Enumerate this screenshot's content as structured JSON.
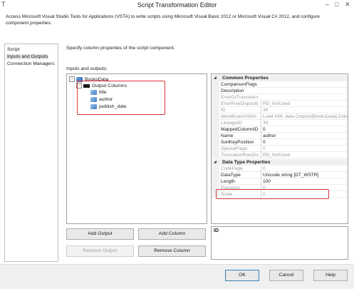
{
  "window": {
    "title": "Script Transformation Editor",
    "app_icon": "T",
    "minimize_glyph": "–",
    "maximize_glyph": "□",
    "close_glyph": "✕"
  },
  "description": "Access Microsoft Visual Studio Tools for Applications (VSTA) to write scripts using Microsoft Visual Basic 2012 or Microsoft Visual C# 2012, and configure component properties.",
  "nav": {
    "items": [
      {
        "label": "Script",
        "selected": false
      },
      {
        "label": "Inputs and Outputs",
        "selected": true
      },
      {
        "label": "Connection Managers",
        "selected": false
      }
    ]
  },
  "main": {
    "prompt": "Specify column properties of the script component.",
    "io_label": "Inputs and outputs:"
  },
  "tree": {
    "root": {
      "label": "BooksData",
      "expander": "−",
      "icon": "component-icon"
    },
    "folder": {
      "label": "Output Columns",
      "expander": "−",
      "icon": "folder-icon"
    },
    "columns": [
      {
        "label": "title",
        "icon": "column-icon"
      },
      {
        "label": "author",
        "icon": "column-icon"
      },
      {
        "label": "publish_date",
        "icon": "column-icon"
      }
    ]
  },
  "properties": {
    "common_header": "Common Properties",
    "common_rows": [
      {
        "name": "ComparisonFlags",
        "value": "",
        "readonly": false
      },
      {
        "name": "Description",
        "value": "",
        "readonly": false
      },
      {
        "name": "ErrorOrTruncation",
        "value": "",
        "readonly": true
      },
      {
        "name": "ErrorRowDispositi",
        "value": "RD_NotUsed",
        "readonly": true
      },
      {
        "name": "ID",
        "value": "39",
        "readonly": true
      },
      {
        "name": "IdentificationStrin",
        "value": "Load XML data.Outputs[BooksData].Colu",
        "readonly": true
      },
      {
        "name": "LineageID",
        "value": "39",
        "readonly": true
      },
      {
        "name": "MappedColumnID",
        "value": "0",
        "readonly": false
      },
      {
        "name": "Name",
        "value": "author",
        "readonly": false
      },
      {
        "name": "SortKeyPosition",
        "value": "0",
        "readonly": false
      },
      {
        "name": "SpecialFlags",
        "value": "0",
        "readonly": true
      },
      {
        "name": "TruncationRowDis",
        "value": "RD_NotUsed",
        "readonly": true
      }
    ],
    "datatype_header": "Data Type Properties",
    "datatype_rows": [
      {
        "name": "CodePage",
        "value": "0",
        "readonly": true
      },
      {
        "name": "DataType",
        "value": "Unicode string [DT_WSTR]",
        "readonly": false
      },
      {
        "name": "Length",
        "value": "100",
        "readonly": false
      },
      {
        "name": "Precision",
        "value": "0",
        "readonly": true
      },
      {
        "name": "Scale",
        "value": "0",
        "readonly": true
      }
    ],
    "description_title": "ID"
  },
  "buttons": {
    "add_output": "Add Output",
    "add_column": "Add Column",
    "remove_output": "Remove Output",
    "remove_column": "Remove Column",
    "ok": "OK",
    "cancel": "Cancel",
    "help": "Help"
  },
  "colors": {
    "highlight": "#d9363e",
    "selection": "#e5e5e5",
    "footer_bg": "#f0f0f0"
  }
}
